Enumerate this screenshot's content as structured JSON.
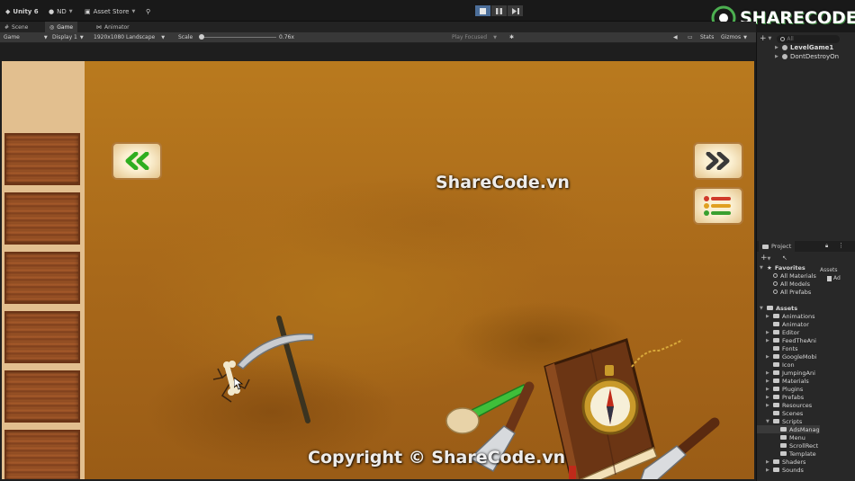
{
  "toolbar": {
    "app_name": "Unity 6",
    "account": "ND",
    "asset_store": "Asset Store"
  },
  "tabs": [
    {
      "label": "Scene"
    },
    {
      "label": "Game"
    },
    {
      "label": "Animator"
    }
  ],
  "gamebar": {
    "mode": "Game",
    "display": "Display 1",
    "resolution": "1920x1080 Landscape",
    "scale_label": "Scale",
    "scale_value": "0.76x",
    "play_focused": "Play Focused",
    "stats": "Stats",
    "gizmos": "Gizmos"
  },
  "hierarchy": {
    "search_placeholder": "All",
    "items": [
      {
        "label": "LevelGame1"
      },
      {
        "label": "DontDestroyOn"
      }
    ]
  },
  "project": {
    "tab_label": "Project",
    "favorites_label": "Favorites",
    "favorites": [
      {
        "label": "All Materials"
      },
      {
        "label": "All Models"
      },
      {
        "label": "All Prefabs"
      }
    ],
    "assets_label": "Assets",
    "assets_header": "Assets",
    "asset_preview": "Ad",
    "folders": [
      {
        "label": "Animations"
      },
      {
        "label": "Animator"
      },
      {
        "label": "Editor"
      },
      {
        "label": "FeedTheAni"
      },
      {
        "label": "Fonts"
      },
      {
        "label": "GoogleMobi"
      },
      {
        "label": "Icon"
      },
      {
        "label": "JumpingAni"
      },
      {
        "label": "Materials"
      },
      {
        "label": "Plugins"
      },
      {
        "label": "Prefabs"
      },
      {
        "label": "Resources"
      },
      {
        "label": "Scenes"
      },
      {
        "label": "Scripts"
      },
      {
        "label": "AdsManag"
      },
      {
        "label": "Menu"
      },
      {
        "label": "ScrollRect"
      },
      {
        "label": "Template"
      },
      {
        "label": "Shaders"
      },
      {
        "label": "Sounds"
      }
    ]
  },
  "watermarks": {
    "center": "ShareCode.vn",
    "bottom": "Copyright © ShareCode.vn",
    "logo": "SHARECODE.vn"
  },
  "colors": {
    "accent": "#4c6e99",
    "logo_green": "#4caf50",
    "arrow_green": "#2fae1f"
  }
}
